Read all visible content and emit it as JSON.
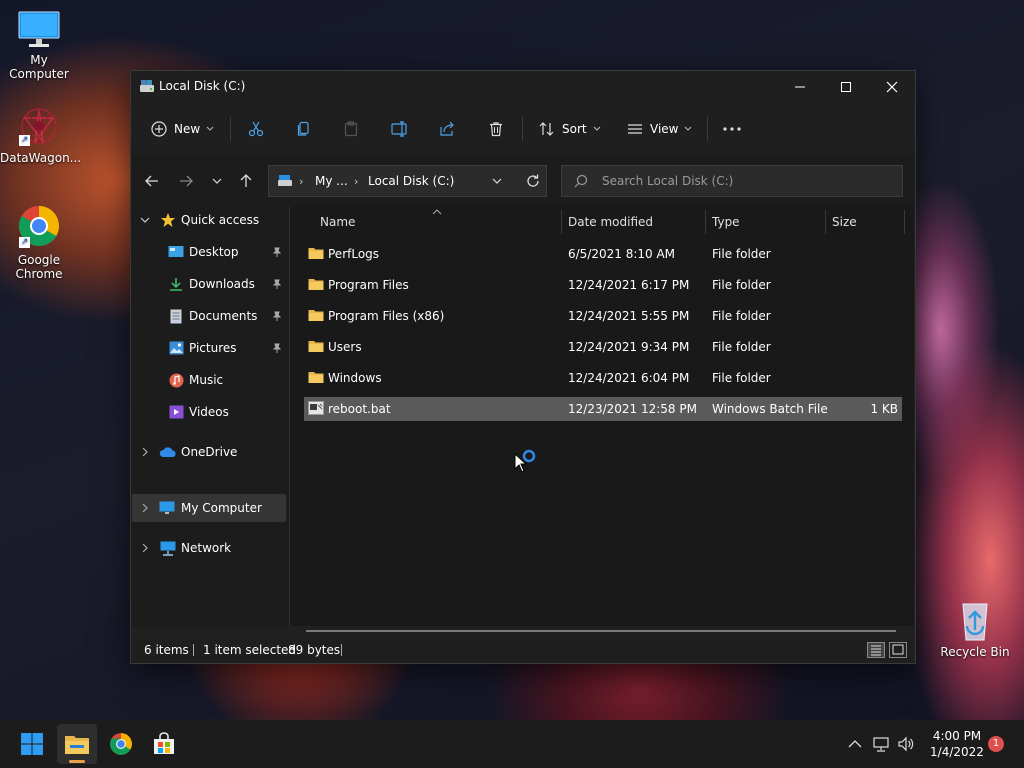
{
  "desktop": {
    "icons": [
      {
        "label": "My Computer"
      },
      {
        "label": "DataWagon..."
      },
      {
        "label": "Google Chrome"
      },
      {
        "label": "Recycle Bin"
      }
    ]
  },
  "window": {
    "title": "Local Disk (C:)",
    "toolbar": {
      "new_label": "New",
      "sort_label": "Sort",
      "view_label": "View"
    },
    "address": {
      "segments": [
        "My ...",
        "Local Disk (C:)"
      ]
    },
    "search": {
      "placeholder": "Search Local Disk (C:)"
    },
    "sidebar": {
      "items": [
        {
          "label": "Quick access"
        },
        {
          "label": "Desktop"
        },
        {
          "label": "Downloads"
        },
        {
          "label": "Documents"
        },
        {
          "label": "Pictures"
        },
        {
          "label": "Music"
        },
        {
          "label": "Videos"
        },
        {
          "label": "OneDrive"
        },
        {
          "label": "My Computer"
        },
        {
          "label": "Network"
        }
      ]
    },
    "columns": {
      "name": "Name",
      "date": "Date modified",
      "type": "Type",
      "size": "Size"
    },
    "files": [
      {
        "name": "PerfLogs",
        "date": "6/5/2021 8:10 AM",
        "type": "File folder",
        "size": ""
      },
      {
        "name": "Program Files",
        "date": "12/24/2021 6:17 PM",
        "type": "File folder",
        "size": ""
      },
      {
        "name": "Program Files (x86)",
        "date": "12/24/2021 5:55 PM",
        "type": "File folder",
        "size": ""
      },
      {
        "name": "Users",
        "date": "12/24/2021 9:34 PM",
        "type": "File folder",
        "size": ""
      },
      {
        "name": "Windows",
        "date": "12/24/2021 6:04 PM",
        "type": "File folder",
        "size": ""
      },
      {
        "name": "reboot.bat",
        "date": "12/23/2021 12:58 PM",
        "type": "Windows Batch File",
        "size": "1 KB"
      }
    ],
    "status": {
      "items_count": "6 items",
      "selection": "1 item selected",
      "selection_size": "89 bytes"
    }
  },
  "taskbar": {
    "time": "4:00 PM",
    "date": "1/4/2022",
    "notification_count": "1"
  },
  "colors": {
    "accent": "#0078d4",
    "folder": "#e8b64a",
    "selected_row": "#5a5a5a"
  }
}
